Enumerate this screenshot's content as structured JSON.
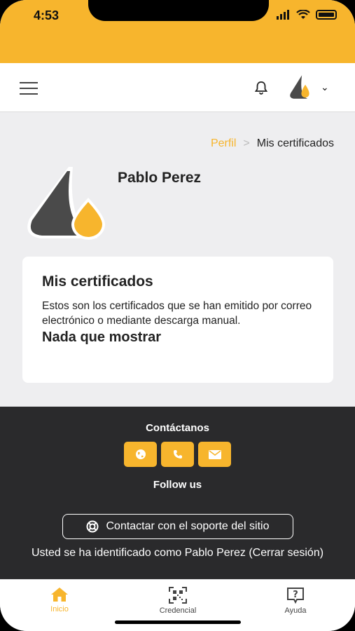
{
  "status_bar": {
    "time": "4:53"
  },
  "breadcrumb": {
    "parent": "Perfil",
    "separator": ">",
    "current": "Mis certificados"
  },
  "profile": {
    "name": "Pablo Perez"
  },
  "card": {
    "title": "Mis certificados",
    "description": "Estos son los certificados que se han emitido por correo electrónico o mediante descarga manual.",
    "empty": "Nada que mostrar"
  },
  "footer": {
    "contact_title": "Contáctanos",
    "follow": "Follow us",
    "support": "Contactar con el soporte del sitio",
    "identified": "Usted se ha identificado como Pablo Perez (Cerrar sesión)"
  },
  "bottom_nav": [
    {
      "label": "Inicio",
      "icon": "home-icon",
      "active": true
    },
    {
      "label": "Credencial",
      "icon": "qr-code-icon",
      "active": false
    },
    {
      "label": "Ayuda",
      "icon": "help-icon",
      "active": false
    }
  ],
  "colors": {
    "accent": "#f7b52d",
    "footer_bg": "#2a2a2c",
    "page_bg": "#eeeef0"
  }
}
